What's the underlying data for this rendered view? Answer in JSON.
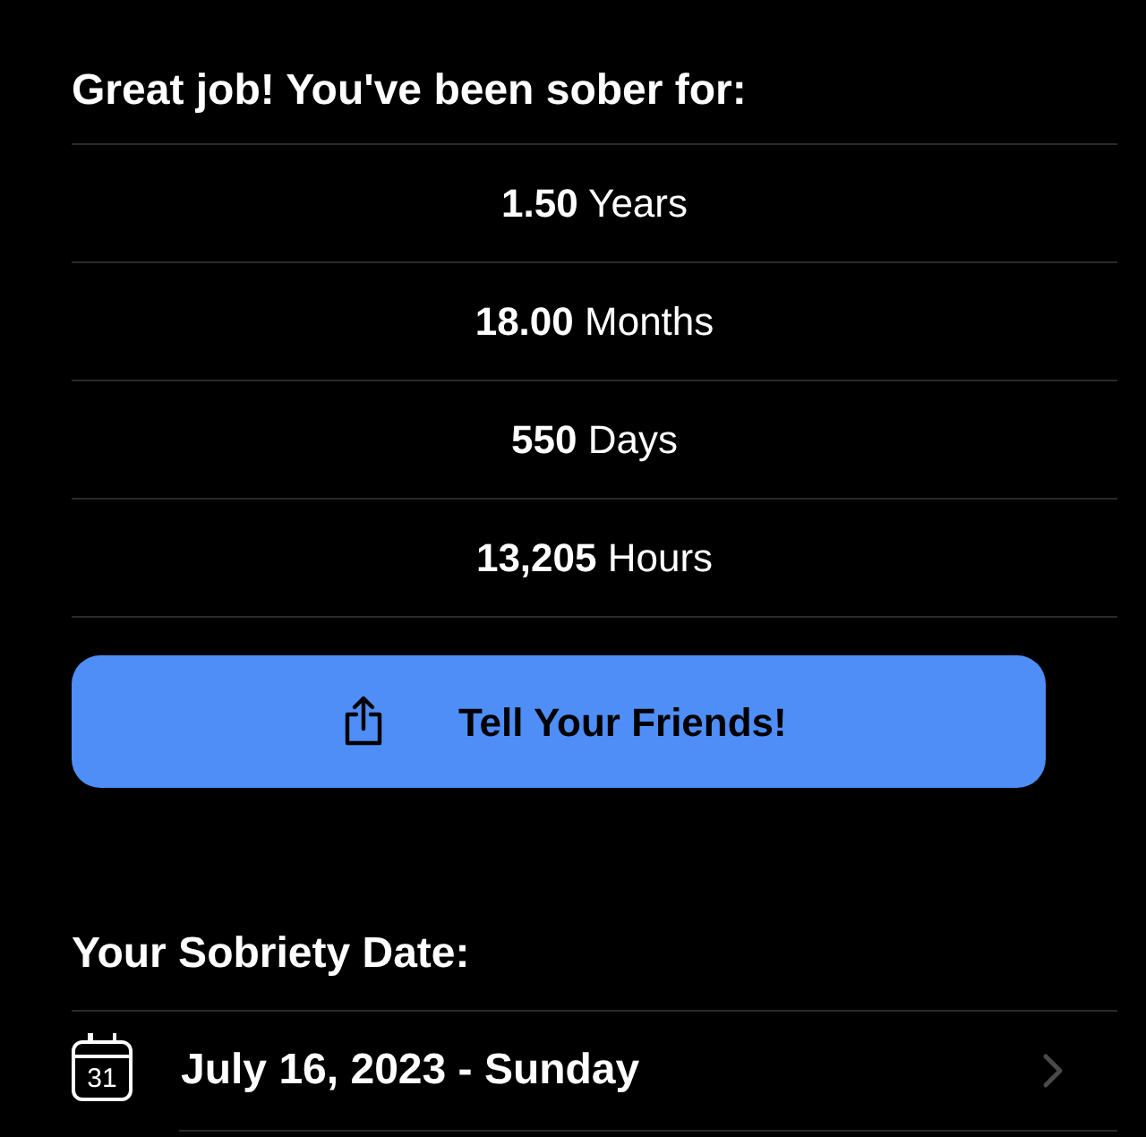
{
  "heading": "Great job! You've been sober for:",
  "stats": [
    {
      "text": "**1.50** Years"
    },
    {
      "text": "**18.00** Months"
    },
    {
      "text": "**550** Days"
    },
    {
      "text": "**13,205** Hours"
    }
  ],
  "share_button": {
    "label": "Tell Your Friends!"
  },
  "date_section": {
    "heading": "Your Sobriety Date:",
    "icon_day": "31",
    "date": "July 16, 2023 - Sunday"
  }
}
